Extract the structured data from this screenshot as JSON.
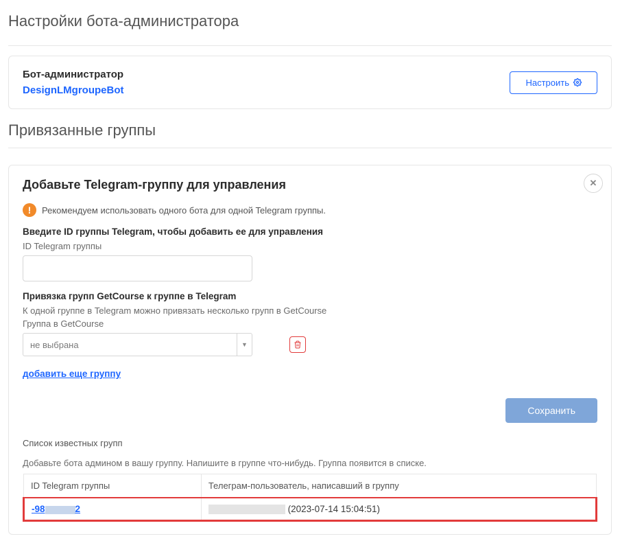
{
  "page": {
    "title": "Настройки бота-администратора"
  },
  "bot": {
    "label": "Бот-администратор",
    "name": "DesignLMgroupeBot",
    "configure_btn": "Настроить"
  },
  "linked_section": {
    "title": "Привязанные группы"
  },
  "panel": {
    "title": "Добавьте Telegram-группу для управления",
    "alert_text": "Рекомендуем использовать одного бота для одной Telegram группы.",
    "id_subhead": "Введите ID группы Telegram, чтобы добавить ее для управления",
    "id_label": "ID Telegram группы",
    "bind_subhead": "Привязка групп GetCourse к группе в Telegram",
    "bind_help": "К одной группе в Telegram можно привязать несколько групп в GetCourse",
    "gc_label": "Группа в GetCourse",
    "select_placeholder": "не выбрана",
    "add_link": "добавить еще группу",
    "save_btn": "Сохранить",
    "known_title": "Список известных групп",
    "known_help": "Добавьте бота админом в вашу группу. Напишите в группе что-нибудь. Группа появится в списке.",
    "table": {
      "col_id": "ID Telegram группы",
      "col_user": "Телеграм-пользователь, написавший в группу",
      "row": {
        "id_prefix": "-98",
        "id_suffix": "2",
        "timestamp": "(2023-07-14 15:04:51)"
      }
    }
  }
}
